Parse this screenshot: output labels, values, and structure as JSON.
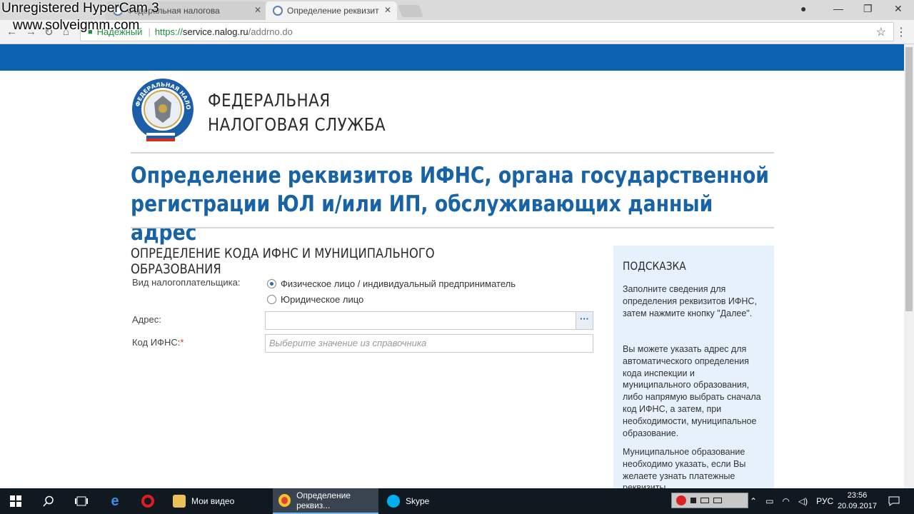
{
  "watermark": {
    "line1": "Unregistered HyperCam 3",
    "line2": "www.solveigmm.com"
  },
  "browser": {
    "tabs": [
      {
        "title": "Федеральная налогова",
        "active": false
      },
      {
        "title": "Определение реквизит",
        "active": true
      }
    ],
    "tab_close": "✕",
    "window_buttons": {
      "minimize": "—",
      "maximize": "❐",
      "close": "✕",
      "profile": "●"
    },
    "nav": {
      "back": "←",
      "forward": "→",
      "reload": "↻",
      "home": "⌂"
    },
    "address": {
      "secure_label": "Надежный",
      "scheme": "https://",
      "host": "service.nalog.ru",
      "path": "/addrno.do"
    },
    "bookmark_icon": "☆",
    "menu_icon": "⋮"
  },
  "header": {
    "org_name_line1": "ФЕДЕРАЛЬНАЯ",
    "org_name_line2": "НАЛОГОВАЯ СЛУЖБА",
    "logo_text": "ФЕДЕРАЛЬНАЯ НАЛОГОВАЯ СЛУЖБА"
  },
  "page": {
    "title_line1": "Определение реквизитов ИФНС, органа государственной",
    "title_line2": "регистрации ЮЛ и/или ИП, обслуживающих данный адрес",
    "section_title": "ОПРЕДЕЛЕНИЕ КОДА ИФНС И МУНИЦИПАЛЬНОГО ОБРАЗОВАНИЯ"
  },
  "form": {
    "taxpayer_label": "Вид налогоплательщика:",
    "options": [
      {
        "label": "Физическое лицо / индивидуальный предприниматель",
        "checked": true
      },
      {
        "label": "Юридическое лицо",
        "checked": false
      }
    ],
    "address_label": "Адрес:",
    "address_value": "",
    "address_button": "···",
    "ifns_label": "Код ИФНС:",
    "required_mark": "*",
    "ifns_placeholder": "Выберите значение из справочника"
  },
  "hint": {
    "title": "ПОДСКАЗКА",
    "p1": "Заполните сведения для определения реквизитов ИФНС, затем нажмите кнопку \"Далее\".",
    "p2": "Вы можете указать адрес для автоматического определения кода инспекции и муниципального образования, либо напрямую выбрать сначала код ИФНС, а затем, при необходимости, муниципальное образование.",
    "p3": "Муниципальное образование необходимо указать, если Вы желаете узнать платежные реквизиты"
  },
  "taskbar": {
    "apps": [
      {
        "label": "Мои видео",
        "active": false
      },
      {
        "label": "Определение реквиз...",
        "active": true
      },
      {
        "label": "Skype",
        "active": false
      }
    ],
    "language": "РУС",
    "time": "23:56",
    "date": "20.09.2017"
  },
  "colors": {
    "brand_blue": "#0b62b0",
    "title_blue": "#1763a6",
    "hint_bg": "#e6f1fb"
  }
}
